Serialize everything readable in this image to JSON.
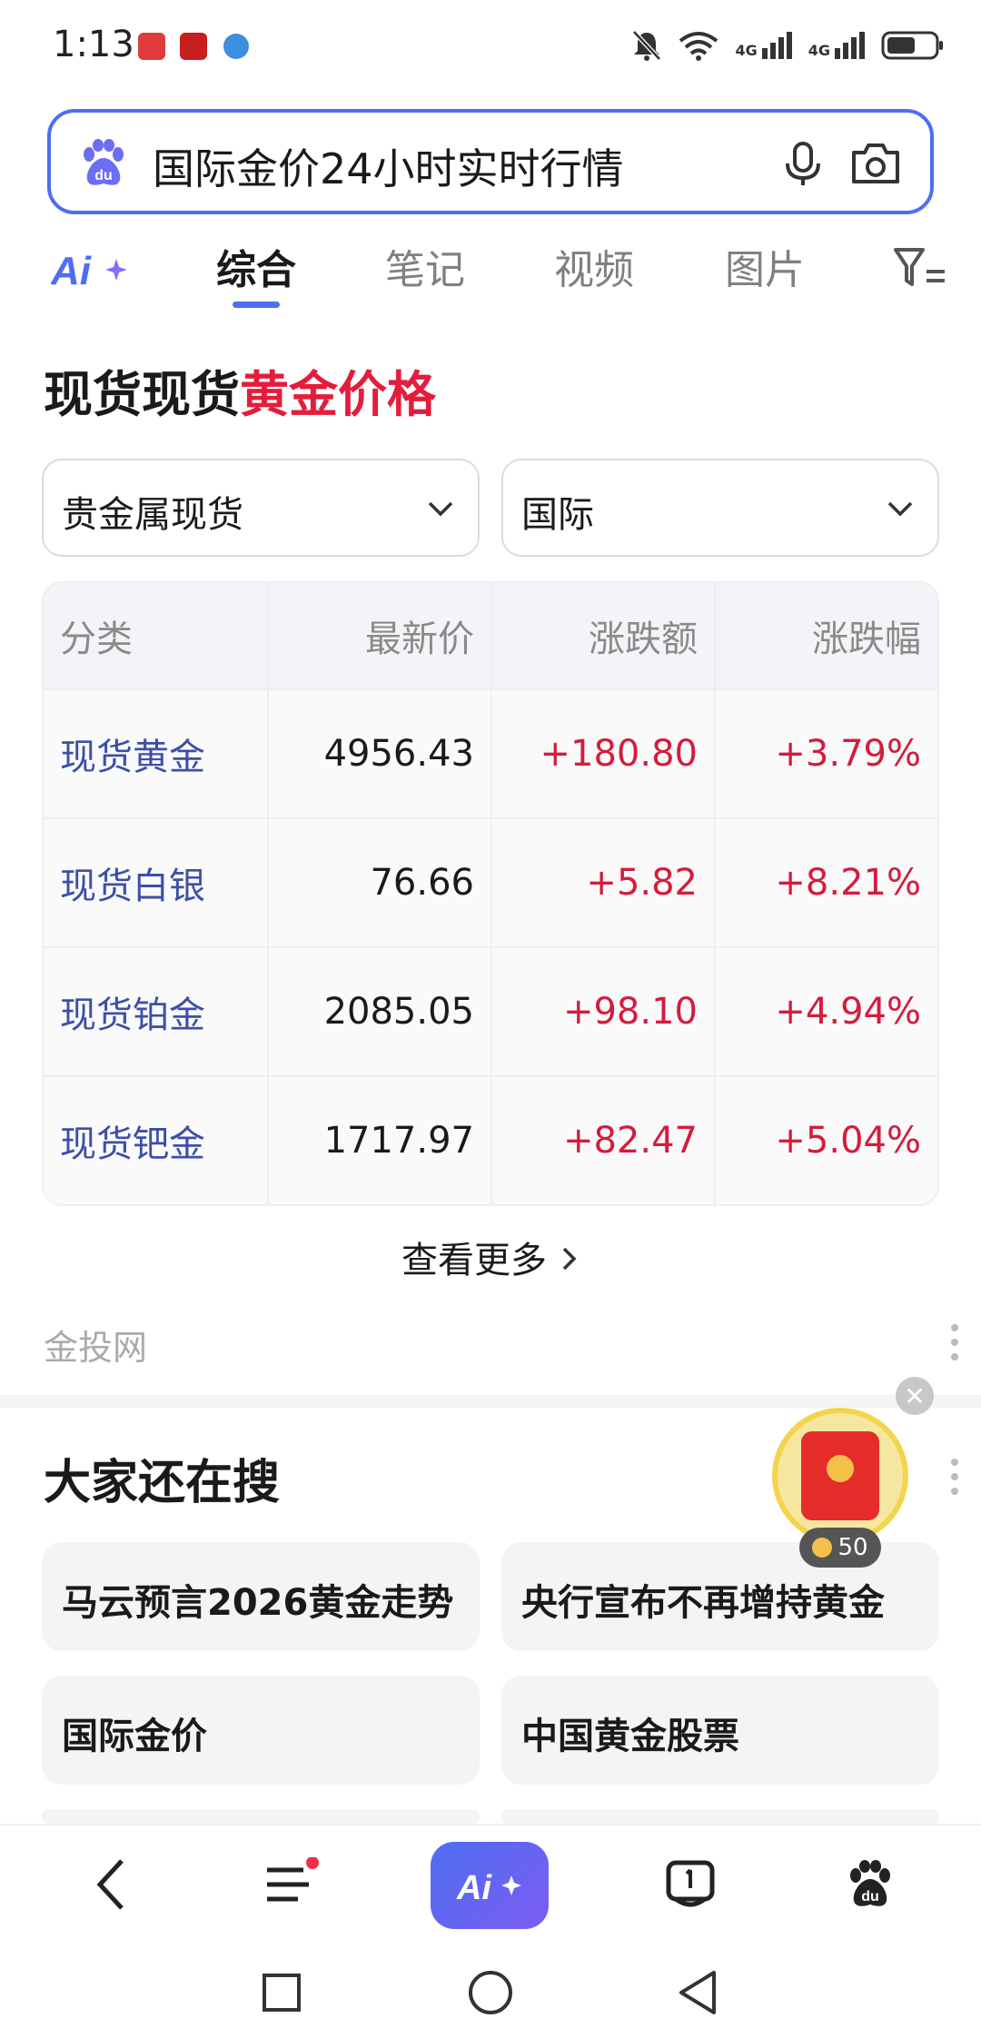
{
  "status": {
    "time": "1:13",
    "network_a": "4G",
    "network_b": "4G"
  },
  "search": {
    "query": "国际金价24小时实时行情"
  },
  "tabs": [
    {
      "label": "综合",
      "active": true
    },
    {
      "label": "笔记",
      "active": false
    },
    {
      "label": "视频",
      "active": false
    },
    {
      "label": "图片",
      "active": false
    }
  ],
  "card": {
    "title_plain": "现货现货",
    "title_highlight": "黄金价格",
    "dropdown_type": "贵金属现货",
    "dropdown_region": "国际",
    "table": {
      "headers": [
        "分类",
        "最新价",
        "涨跌额",
        "涨跌幅"
      ],
      "rows": [
        {
          "name": "现货黄金",
          "price": "4956.43",
          "change": "+180.80",
          "pct": "+3.79%"
        },
        {
          "name": "现货白银",
          "price": "76.66",
          "change": "+5.82",
          "pct": "+8.21%"
        },
        {
          "name": "现货铂金",
          "price": "2085.05",
          "change": "+98.10",
          "pct": "+4.94%"
        },
        {
          "name": "现货钯金",
          "price": "1717.97",
          "change": "+82.47",
          "pct": "+5.04%"
        }
      ]
    },
    "view_more": "查看更多",
    "source": "金投网"
  },
  "related": {
    "title": "大家还在搜",
    "items": [
      "马云预言2026黄金走势",
      "央行宣布不再增持黄金",
      "国际金价",
      "中国黄金股票"
    ]
  },
  "red_packet": {
    "coins": "50"
  },
  "colors": {
    "accent": "#4e6ef2",
    "up_red": "#d41c3c",
    "link_blue": "#3c4fa8"
  }
}
